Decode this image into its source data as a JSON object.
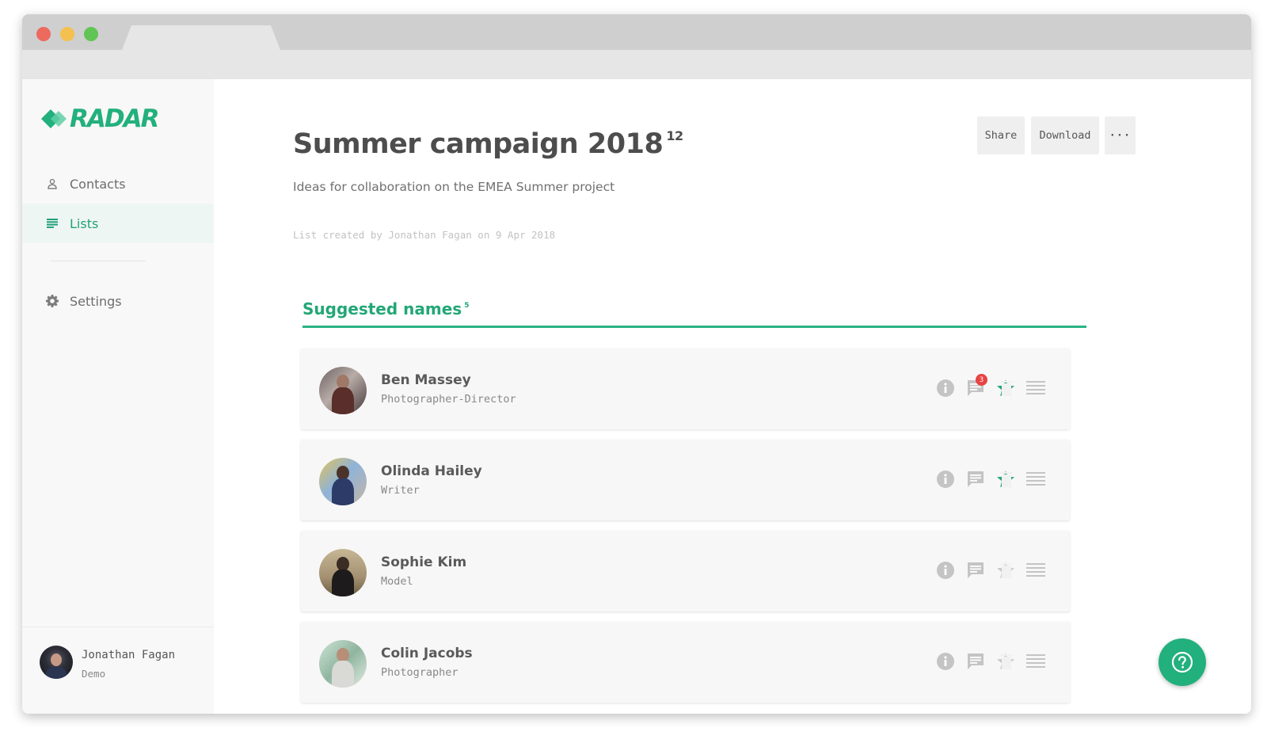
{
  "brand": {
    "name": "RADAR",
    "accent": "#22b07d"
  },
  "sidebar": {
    "items": [
      {
        "label": "Contacts",
        "icon": "person-icon",
        "active": false
      },
      {
        "label": "Lists",
        "icon": "list-icon",
        "active": true
      },
      {
        "label": "Settings",
        "icon": "gear-icon",
        "active": false
      }
    ],
    "user": {
      "name": "Jonathan Fagan",
      "role": "Demo"
    }
  },
  "header": {
    "title": "Summer campaign 2018",
    "count": "12",
    "description": "Ideas for collaboration on the EMEA Summer project",
    "meta": "List created by Jonathan Fagan on 9 Apr 2018",
    "buttons": {
      "share": "Share",
      "download": "Download",
      "more": "···"
    }
  },
  "section": {
    "title": "Suggested names",
    "count": "5"
  },
  "people": [
    {
      "name": "Ben Massey",
      "role": "Photographer-Director",
      "starred": true,
      "comments_badge": "3"
    },
    {
      "name": "Olinda Hailey",
      "role": "Writer",
      "starred": true,
      "comments_badge": ""
    },
    {
      "name": "Sophie Kim",
      "role": "Model",
      "starred": false,
      "comments_badge": ""
    },
    {
      "name": "Colin Jacobs",
      "role": "Photographer",
      "starred": false,
      "comments_badge": ""
    }
  ],
  "colors": {
    "star_active": "#22a777",
    "star_inactive": "#c9c9c9",
    "icon": "#c4c4c4",
    "badge": "#e84343"
  }
}
